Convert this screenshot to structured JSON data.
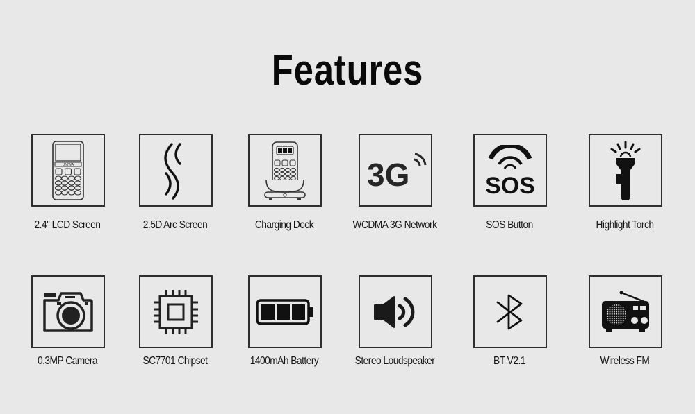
{
  "title": "Features",
  "features": [
    {
      "label": "2.4'' LCD Screen",
      "icon": "phone-lcd-icon"
    },
    {
      "label": "2.5D Arc Screen",
      "icon": "arc-screen-icon"
    },
    {
      "label": "Charging Dock",
      "icon": "charging-dock-icon"
    },
    {
      "label": "WCDMA 3G Network",
      "icon": "3g-network-icon",
      "icon_text": "3G"
    },
    {
      "label": "SOS Button",
      "icon": "sos-icon",
      "icon_text": "SOS"
    },
    {
      "label": "Highlight Torch",
      "icon": "torch-icon"
    },
    {
      "label": "0.3MP Camera",
      "icon": "camera-icon"
    },
    {
      "label": "SC7701 Chipset",
      "icon": "chipset-icon"
    },
    {
      "label": "1400mAh Battery",
      "icon": "battery-icon"
    },
    {
      "label": "Stereo Loudspeaker",
      "icon": "speaker-icon"
    },
    {
      "label": "BT V2.1",
      "icon": "bluetooth-icon"
    },
    {
      "label": "Wireless FM",
      "icon": "radio-icon"
    }
  ],
  "colors": {
    "background": "#e8e8e8",
    "ink": "#111111",
    "border": "#2e2e2e"
  }
}
